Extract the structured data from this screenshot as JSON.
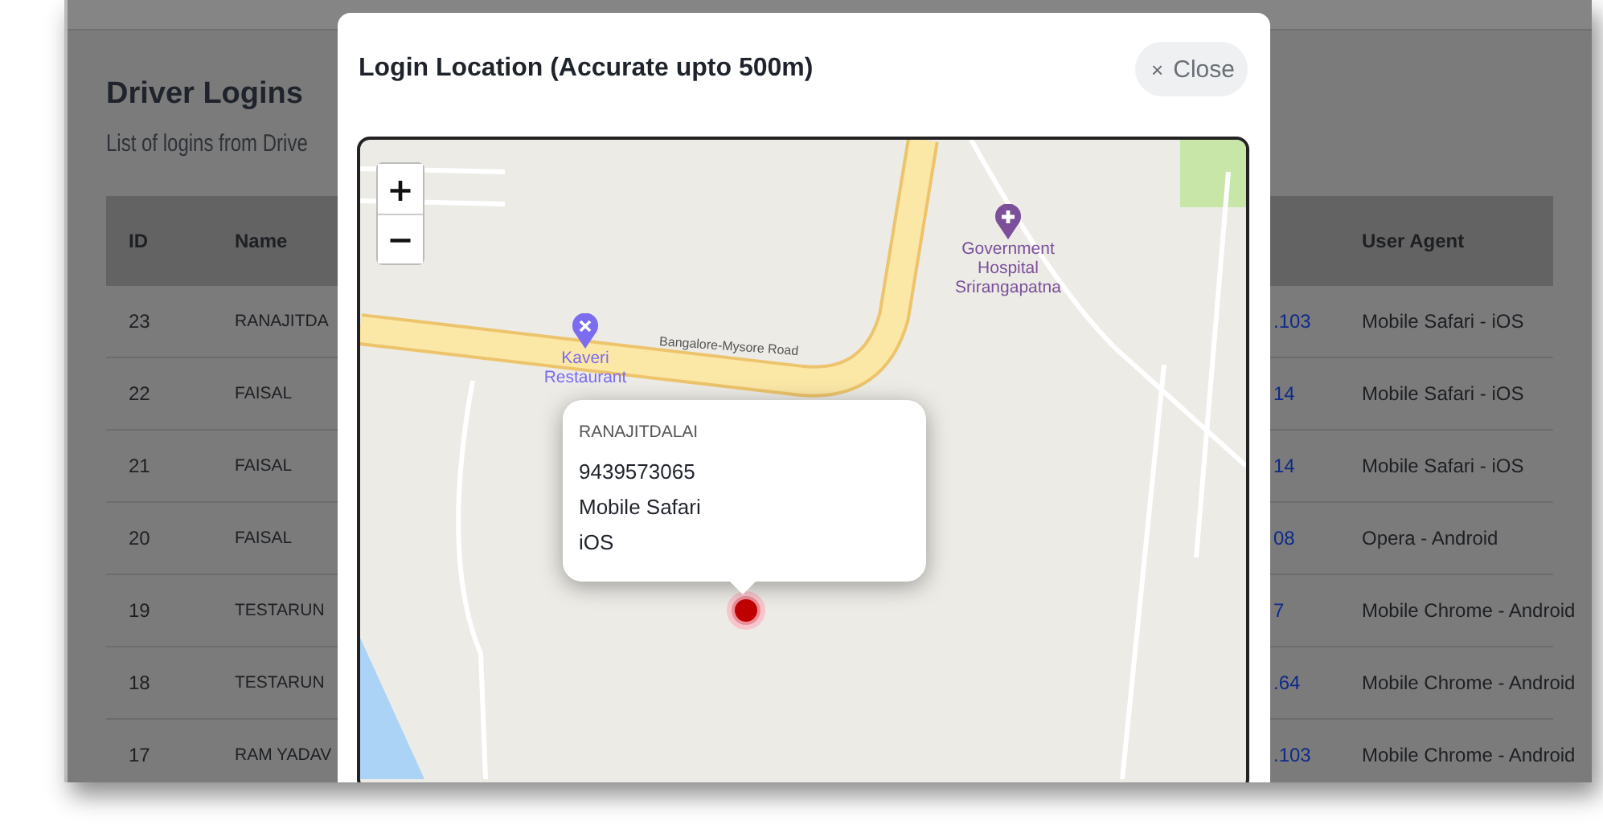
{
  "page": {
    "title": "Driver Logins",
    "subtitle": "List of logins from Drive"
  },
  "table": {
    "columns": {
      "id": "ID",
      "name": "Name",
      "user_agent": "User Agent"
    },
    "rows": [
      {
        "id": "23",
        "name": "RANAJITDA",
        "column_3": ".103",
        "user_agent": "Mobile Safari - iOS"
      },
      {
        "id": "22",
        "name": "FAISAL",
        "column_3": "14",
        "user_agent": "Mobile Safari - iOS"
      },
      {
        "id": "21",
        "name": "FAISAL",
        "column_3": "14",
        "user_agent": "Mobile Safari - iOS"
      },
      {
        "id": "20",
        "name": "FAISAL",
        "column_3": "08",
        "user_agent": "Opera - Android"
      },
      {
        "id": "19",
        "name": "TESTARUN",
        "column_3": "7",
        "user_agent": "Mobile Chrome - Android"
      },
      {
        "id": "18",
        "name": "TESTARUN",
        "column_3": ".64",
        "user_agent": "Mobile Chrome - Android"
      },
      {
        "id": "17",
        "name": "RAM YADAV",
        "column_3": ".103",
        "user_agent": "Mobile Chrome - Android"
      }
    ]
  },
  "modal": {
    "title": "Login Location (Accurate upto 500m)",
    "close": {
      "icon": "×",
      "label": "Close"
    },
    "map": {
      "zoom_in": "+",
      "zoom_out": "−",
      "road_label": "Bangalore-Mysore Road",
      "places": [
        {
          "kind": "hospital",
          "name": "Government Hospital Srirangapatna"
        },
        {
          "kind": "restaurant",
          "name": "Kaveri Restaurant"
        }
      ],
      "popup": {
        "title": "RANAJITDALAI",
        "lines": [
          "9439573065",
          "Mobile Safari",
          "iOS"
        ]
      }
    }
  }
}
